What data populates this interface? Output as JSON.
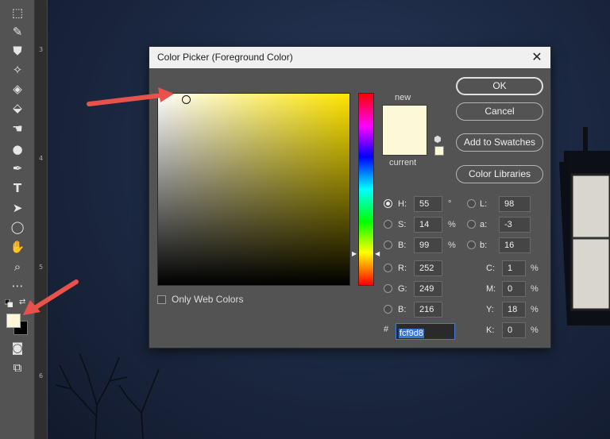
{
  "dialog": {
    "title": "Color Picker (Foreground Color)",
    "close_label": "✕",
    "new_label": "new",
    "current_label": "current",
    "buttons": {
      "ok": "OK",
      "cancel": "Cancel",
      "add_to_swatches": "Add to Swatches",
      "color_libraries": "Color Libraries"
    },
    "only_web_colors_label": "Only Web Colors",
    "only_web_colors_checked": false,
    "selected_color": "#fcf9d8",
    "hue_color": "#ffe500",
    "hsb": {
      "h": {
        "label": "H:",
        "value": "55",
        "unit": "°",
        "selected": true
      },
      "s": {
        "label": "S:",
        "value": "14",
        "unit": "%",
        "selected": false
      },
      "b": {
        "label": "B:",
        "value": "99",
        "unit": "%",
        "selected": false
      }
    },
    "rgb": {
      "r": {
        "label": "R:",
        "value": "252"
      },
      "g": {
        "label": "G:",
        "value": "249"
      },
      "b": {
        "label": "B:",
        "value": "216"
      }
    },
    "lab": {
      "l": {
        "label": "L:",
        "value": "98"
      },
      "a": {
        "label": "a:",
        "value": "-3"
      },
      "b": {
        "label": "b:",
        "value": "16"
      }
    },
    "cmyk": {
      "c": {
        "label": "C:",
        "value": "1",
        "unit": "%"
      },
      "m": {
        "label": "M:",
        "value": "0",
        "unit": "%"
      },
      "y": {
        "label": "Y:",
        "value": "18",
        "unit": "%"
      },
      "k": {
        "label": "K:",
        "value": "0",
        "unit": "%"
      }
    },
    "hex_hash": "#",
    "hex_value": "fcf9d8"
  },
  "toolbar": {
    "icons": [
      "artboard-icon",
      "brush-icon",
      "stamp-icon",
      "healing-icon",
      "eraser-icon",
      "paint-bucket-icon",
      "smudge-icon",
      "dodge-icon",
      "pen-icon",
      "type-icon",
      "path-select-icon",
      "ellipse-icon",
      "hand-icon",
      "zoom-icon",
      "more-icon"
    ],
    "foreground_color": "#fcf9d8",
    "background_color": "#000000"
  },
  "ruler": {
    "marks": [
      "3",
      "4",
      "5",
      "6"
    ]
  },
  "colors": {
    "annotation_arrow": "#e8524a",
    "dialog_bg": "#535353"
  }
}
